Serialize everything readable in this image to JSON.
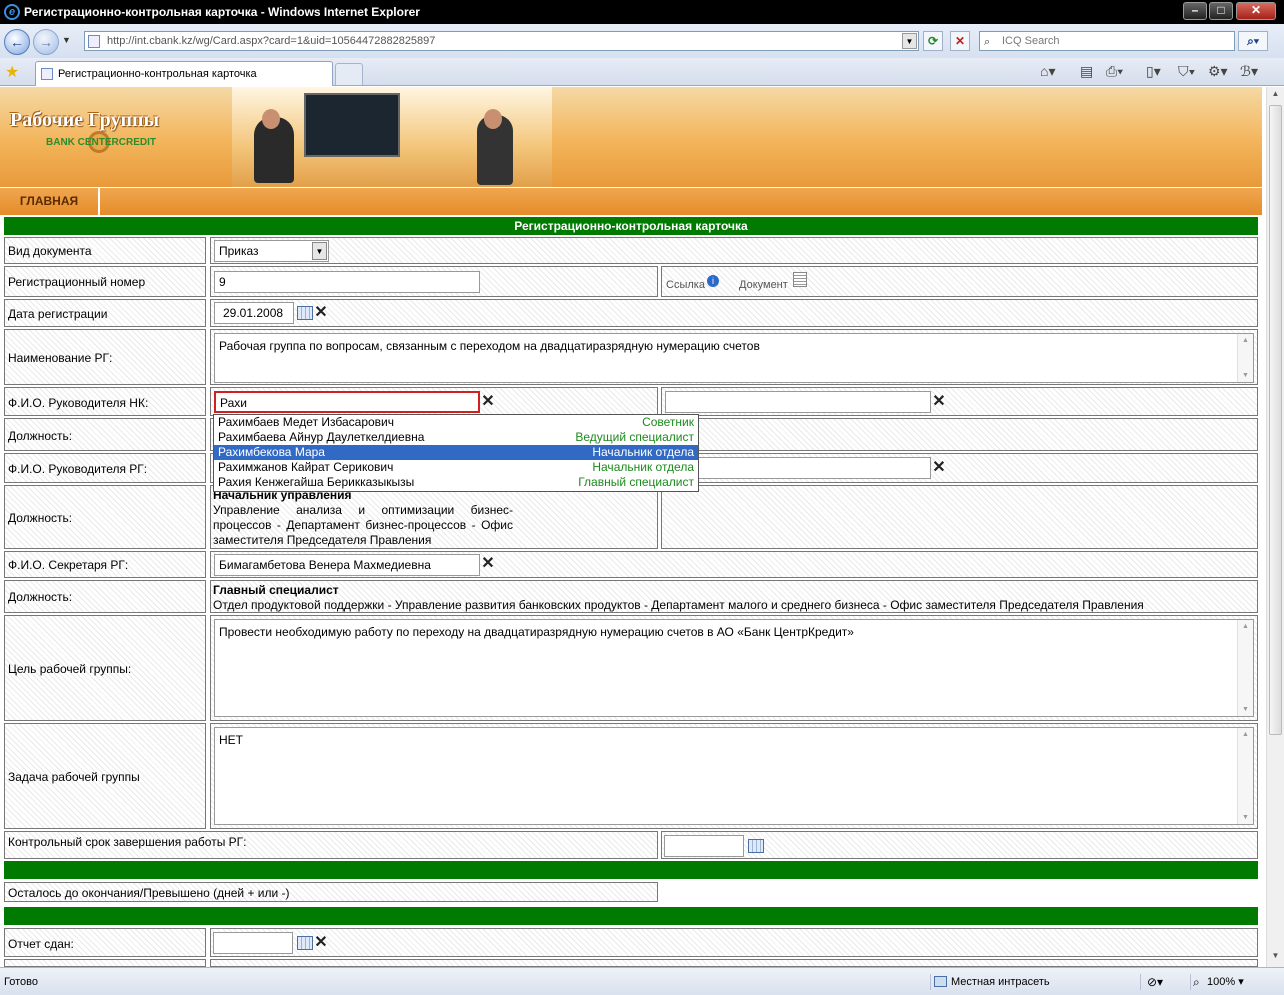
{
  "window": {
    "title": "Регистрационно-контрольная карточка - Windows Internet Explorer",
    "url": "http://int.cbank.kz/wg/Card.aspx?card=1&uid=10564472882825897",
    "search_placeholder": "ICQ Search",
    "tab_title": "Регистрационно-контрольная карточка",
    "status_text": "Готово",
    "zone": "Местная интрасеть",
    "zoom": "100%"
  },
  "banner": {
    "logo_title": "Рабочие Группы",
    "logo_sub": "BANK   CENTERCREDIT",
    "nav_home": "ГЛАВНАЯ"
  },
  "form": {
    "header": "Регистрационно-контрольная карточка",
    "doc_type_label": "Вид документа",
    "doc_type_value": "Приказ",
    "reg_no_label": "Регистрационный номер",
    "reg_no_value": "9",
    "link_label": "Ссылка",
    "document_label": "Документ",
    "reg_date_label": "Дата регистрации",
    "reg_date_value": "29.01.2008",
    "rg_name_label": "Наименование РГ:",
    "rg_name_value": "Рабочая группа по вопросам, связанным с переходом на двадцатиразрядную нумерацию счетов",
    "nk_head_label": "Ф.И.О. Руководителя НК:",
    "nk_head_value": "Рахи",
    "nk_head_position_label": "Должность:",
    "rg_head_label": "Ф.И.О. Руководителя РГ:",
    "rg_head_position_label": "Должность:",
    "rg_head_position_title": "Начальник управления",
    "rg_head_position_dept": "Управление анализа и оптимизации бизнес-процессов - Департамент бизнес-процессов - Офис заместителя Председателя Правления",
    "secretary_label": "Ф.И.О. Секретаря РГ:",
    "secretary_value": "Бимагамбетова Венера Махмедиевна",
    "secretary_position_label": "Должность:",
    "secretary_position_title": "Главный специалист",
    "secretary_position_dept": "Отдел продуктовой поддержки - Управление развития банковских продуктов - Департамент малого и среднего бизнеса - Офис заместителя Председателя Правления",
    "goal_label": "Цель рабочей группы:",
    "goal_value": "Провести необходимую работу по переходу на двадцатиразрядную нумерацию счетов в  АО «Банк ЦентрКредит»",
    "task_label": "Задача рабочей группы",
    "task_value": "НЕТ",
    "deadline_label": "Контрольный срок завершения работы РГ:",
    "remaining_label": "Осталось до окончания/Превышено (дней + или -)",
    "report_label": "Отчет сдан:"
  },
  "autocomplete": [
    {
      "name": "Рахимбаев Медет Избасарович",
      "position": "Советник"
    },
    {
      "name": "Рахимбаева Айнур Даулеткелдиевна",
      "position": "Ведущий специалист"
    },
    {
      "name": "Рахимбекова Мара",
      "position": "Начальник отдела"
    },
    {
      "name": "Рахимжанов Кайрат Серикович",
      "position": "Начальник отдела"
    },
    {
      "name": "Рахия Кенжегайша Берикказыкызы",
      "position": "Главный специалист"
    }
  ],
  "colors": {
    "header_green": "#007a00",
    "banner_orange": "#f3b45a",
    "selected_blue": "#316ac5",
    "position_green": "#1b8a1b"
  }
}
